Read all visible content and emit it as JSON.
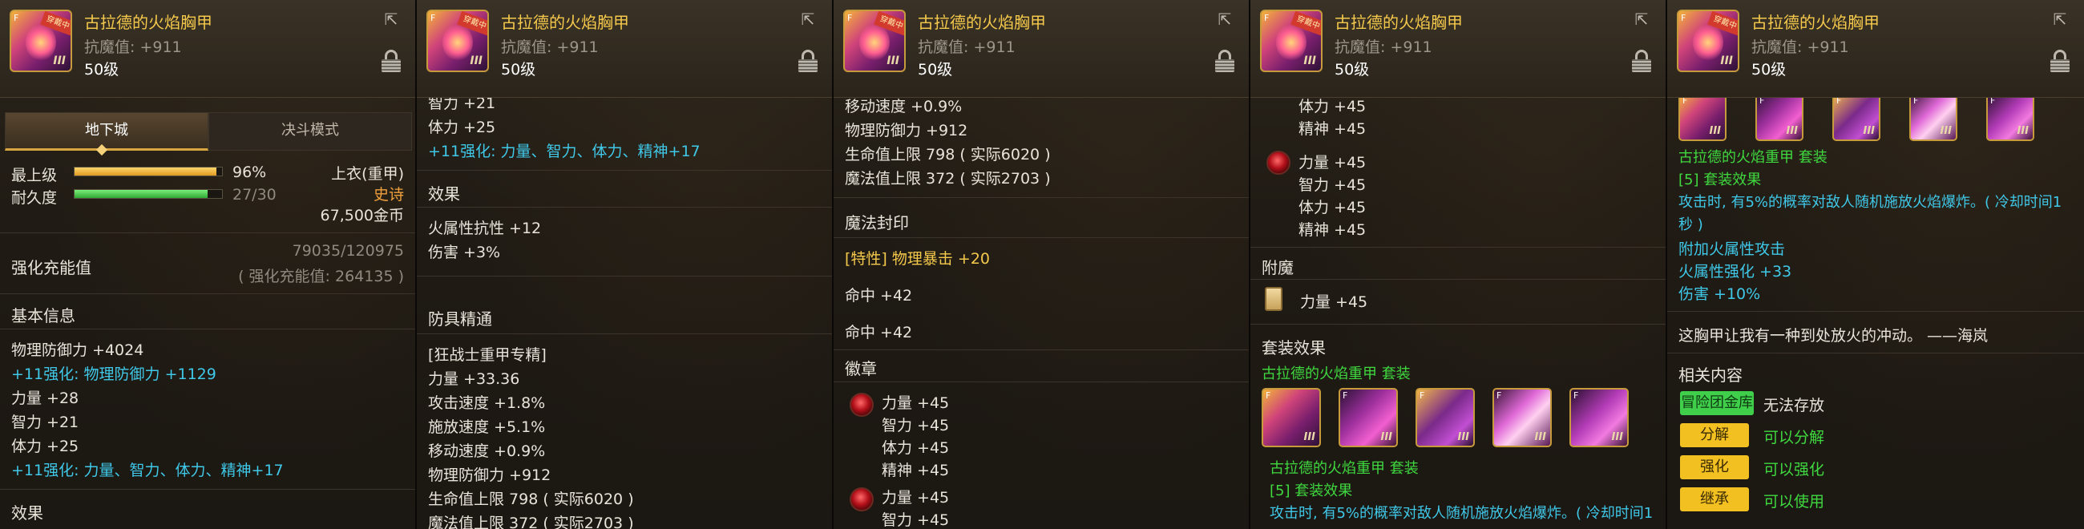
{
  "item": {
    "name": "古拉德的火焰胸甲",
    "magic_resist": "抗魔值: +911",
    "level": "50级",
    "icon_tag": "穿戴中",
    "icon_corner": "F",
    "icon_grade": "III"
  },
  "panel1": {
    "tabs": [
      "地下城",
      "决斗模式"
    ],
    "grade_label": "最上级",
    "grade_value": "96%",
    "grade_fraction": 0.96,
    "durability_label": "耐久度",
    "durability_value": "27/30",
    "durability_fraction": 0.9,
    "slot": "上衣(重甲)",
    "rarity": "史诗",
    "price": "67,500金币",
    "charge_label": "强化充能值",
    "charge_value": "79035/120975",
    "charge_sub": "( 强化充能值: 264135 )",
    "basic_title": "基本信息",
    "lines": [
      {
        "text": "物理防御力 +4024",
        "cls": "white"
      },
      {
        "text": "+11强化: 物理防御力 +1129",
        "cls": "cyan"
      },
      {
        "text": "力量 +28",
        "cls": "white"
      },
      {
        "text": "智力 +21",
        "cls": "white"
      },
      {
        "text": "体力 +25",
        "cls": "white"
      },
      {
        "text": "+11强化: 力量、智力、体力、精神+17",
        "cls": "cyan"
      }
    ],
    "effect_title": "效果"
  },
  "panel2": {
    "top_lines": [
      {
        "text": "智力 +21",
        "cls": "white"
      },
      {
        "text": "体力 +25",
        "cls": "white"
      },
      {
        "text": "+11强化: 力量、智力、体力、精神+17",
        "cls": "cyan"
      }
    ],
    "effect_title": "效果",
    "effect_lines": [
      "火属性抗性 +12",
      "伤害 +3%"
    ],
    "mastery_title": "防具精通",
    "mastery_lines": [
      "[狂战士重甲专精]",
      "力量 +33.36",
      "攻击速度 +1.8%",
      "施放速度 +5.1%",
      "移动速度 +0.9%",
      "物理防御力 +912",
      "生命值上限 798 ( 实际6020 )",
      "魔法值上限 372 ( 实际2703 )"
    ]
  },
  "panel3": {
    "top_lines": [
      "移动速度 +0.9%",
      "物理防御力 +912",
      "生命值上限 798 ( 实际6020 )",
      "魔法值上限 372 ( 实际2703 )"
    ],
    "seal_title": "魔法封印",
    "seal_lines": [
      {
        "text": "[特性] 物理暴击 +20",
        "cls": "gold"
      },
      {
        "text": "命中 +42",
        "cls": "white"
      },
      {
        "text": "命中 +42",
        "cls": "white"
      }
    ],
    "emblem_title": "徽章",
    "emblem1": [
      "力量 +45",
      "智力 +45",
      "体力 +45",
      "精神 +45"
    ],
    "emblem2": [
      "力量 +45",
      "智力 +45"
    ]
  },
  "panel4": {
    "top_lines": [
      "体力 +45",
      "精神 +45"
    ],
    "emblem": [
      "力量 +45",
      "智力 +45",
      "体力 +45",
      "精神 +45"
    ],
    "enchant_title": "附魔",
    "enchant_line": "力量 +45",
    "set_title": "套装效果",
    "set_name": "古拉德的火焰重甲 套装",
    "set_name2": "古拉德的火焰重甲 套装",
    "set_count": "[5] 套装效果",
    "set_desc": "攻击时, 有5%的概率对敌人随机施放火焰爆炸。( 冷却时间1"
  },
  "panel5": {
    "set_name": "古拉德的火焰重甲 套装",
    "set_count": "[5] 套装效果",
    "set_desc1": "攻击时, 有5%的概率对敌人随机施放火焰爆炸。( 冷却时间1",
    "set_desc2": "秒 )",
    "extra_lines": [
      "附加火属性攻击",
      "火属性强化 +33",
      "伤害 +10%"
    ],
    "flavor": "这胸甲让我有一种到处放火的冲动。 ——海岚",
    "related_title": "相关内容",
    "related": [
      {
        "tag": "冒险团金库",
        "desc": "无法存放",
        "tag_cls": "btn-green",
        "desc_cls": "white"
      },
      {
        "tag": "分解",
        "desc": "可以分解",
        "tag_cls": "btn-yellow",
        "desc_cls": "green"
      },
      {
        "tag": "强化",
        "desc": "可以强化",
        "tag_cls": "btn-yellow",
        "desc_cls": "green"
      },
      {
        "tag": "继承",
        "desc": "可以使用",
        "tag_cls": "btn-yellow",
        "desc_cls": "green"
      }
    ]
  },
  "colors": {
    "title": "#f5c94b",
    "enhance": "#3fc8e8",
    "set": "#3fd93f",
    "rarity": "#f0a03c",
    "grade_bar": "#f2b33a",
    "durability_bar": "#3fcf4a"
  },
  "icons": {
    "share": "share-icon",
    "lock": "lock-icon",
    "emblem": "red-emblem-icon",
    "card": "enchant-card-icon"
  }
}
